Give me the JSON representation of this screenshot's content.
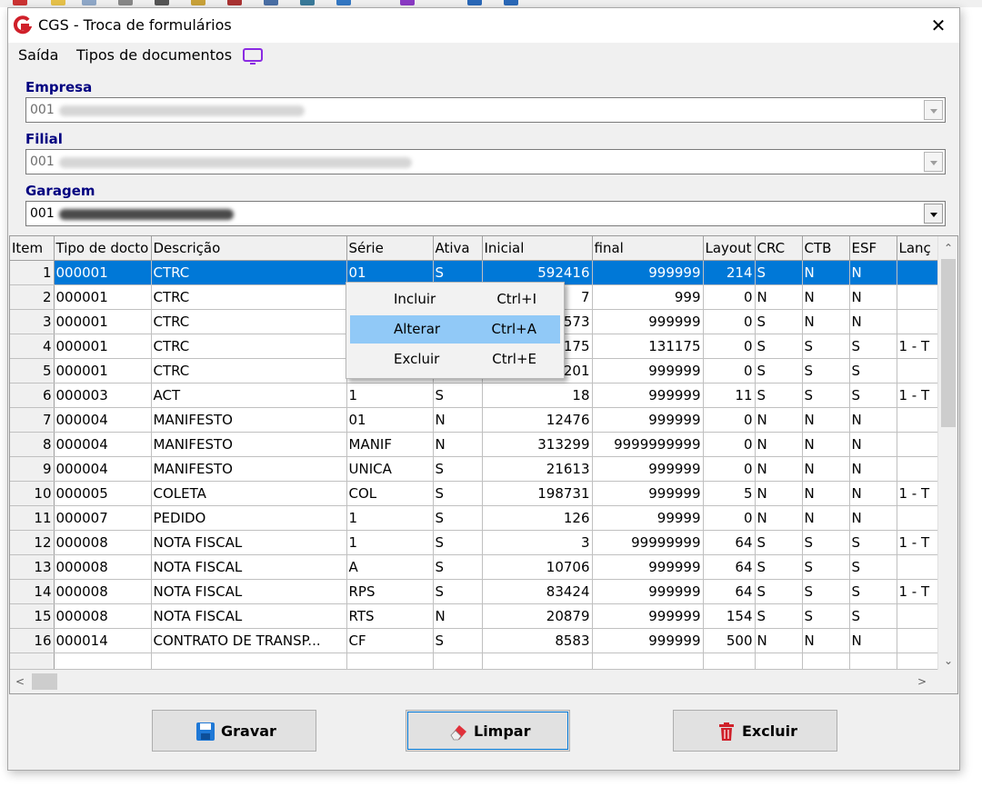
{
  "window": {
    "title": "CGS - Troca de formulários",
    "close_glyph": "✕"
  },
  "menu": {
    "items": [
      "Saída",
      "Tipos de documentos"
    ],
    "screen_icon": "monitor-icon"
  },
  "empresa": {
    "label": "Empresa",
    "value": "001"
  },
  "filial": {
    "label": "Filial",
    "value": "001"
  },
  "garagem": {
    "label": "Garagem",
    "value": "001"
  },
  "grid": {
    "columns": [
      "Item",
      "Tipo de docto",
      "Descrição",
      "Série",
      "Ativa",
      "Inicial",
      "final",
      "Layout",
      "CRC",
      "CTB",
      "ESF",
      "Lanç"
    ],
    "rows": [
      [
        "1",
        "000001",
        "CTRC",
        "01",
        "S",
        "592416",
        "999999",
        "214",
        "S",
        "N",
        "N",
        ""
      ],
      [
        "2",
        "000001",
        "CTRC",
        "",
        "",
        "7",
        "999",
        "0",
        "N",
        "N",
        "N",
        ""
      ],
      [
        "3",
        "000001",
        "CTRC",
        "",
        "",
        "573",
        "999999",
        "0",
        "S",
        "N",
        "N",
        ""
      ],
      [
        "4",
        "000001",
        "CTRC",
        "",
        "",
        "175",
        "131175",
        "0",
        "S",
        "S",
        "S",
        "1 - T"
      ],
      [
        "5",
        "000001",
        "CTRC",
        "",
        "",
        "201",
        "999999",
        "0",
        "S",
        "S",
        "S",
        ""
      ],
      [
        "6",
        "000003",
        "ACT",
        "1",
        "S",
        "18",
        "999999",
        "11",
        "S",
        "S",
        "S",
        "1 - T"
      ],
      [
        "7",
        "000004",
        "MANIFESTO",
        "01",
        "N",
        "12476",
        "999999",
        "0",
        "N",
        "N",
        "N",
        ""
      ],
      [
        "8",
        "000004",
        "MANIFESTO",
        "MANIF",
        "N",
        "313299",
        "9999999999",
        "0",
        "N",
        "N",
        "N",
        ""
      ],
      [
        "9",
        "000004",
        "MANIFESTO",
        "UNICA",
        "S",
        "21613",
        "999999",
        "0",
        "N",
        "N",
        "N",
        ""
      ],
      [
        "10",
        "000005",
        "COLETA",
        "COL",
        "S",
        "198731",
        "999999",
        "5",
        "N",
        "N",
        "N",
        "1 - T"
      ],
      [
        "11",
        "000007",
        "PEDIDO",
        "1",
        "S",
        "126",
        "99999",
        "0",
        "N",
        "N",
        "N",
        ""
      ],
      [
        "12",
        "000008",
        "NOTA FISCAL",
        "1",
        "S",
        "3",
        "99999999",
        "64",
        "S",
        "S",
        "S",
        "1 - T"
      ],
      [
        "13",
        "000008",
        "NOTA FISCAL",
        "A",
        "S",
        "10706",
        "999999",
        "64",
        "S",
        "S",
        "S",
        ""
      ],
      [
        "14",
        "000008",
        "NOTA FISCAL",
        "RPS",
        "S",
        "83424",
        "999999",
        "64",
        "S",
        "S",
        "S",
        "1 - T"
      ],
      [
        "15",
        "000008",
        "NOTA FISCAL",
        "RTS",
        "N",
        "20879",
        "999999",
        "154",
        "S",
        "S",
        "S",
        ""
      ],
      [
        "16",
        "000014",
        "CONTRATO DE TRANSP...",
        "CF",
        "S",
        "8583",
        "999999",
        "500",
        "N",
        "N",
        "N",
        ""
      ]
    ],
    "selected_row": 1
  },
  "context_menu": {
    "items": [
      {
        "label": "Incluir",
        "shortcut": "Ctrl+I"
      },
      {
        "label": "Alterar",
        "shortcut": "Ctrl+A"
      },
      {
        "label": "Excluir",
        "shortcut": "Ctrl+E"
      }
    ],
    "highlighted": "Alterar"
  },
  "buttons": {
    "gravar": {
      "label": "Gravar",
      "icon": "floppy-disk-icon"
    },
    "limpar": {
      "label": "Limpar",
      "icon": "eraser-icon"
    },
    "excluir": {
      "label": "Excluir",
      "icon": "trash-icon"
    }
  },
  "colors": {
    "selection": "#0078d7",
    "menu_highlight": "#91c9f7",
    "label": "#000080",
    "logo": "#d0202a"
  }
}
